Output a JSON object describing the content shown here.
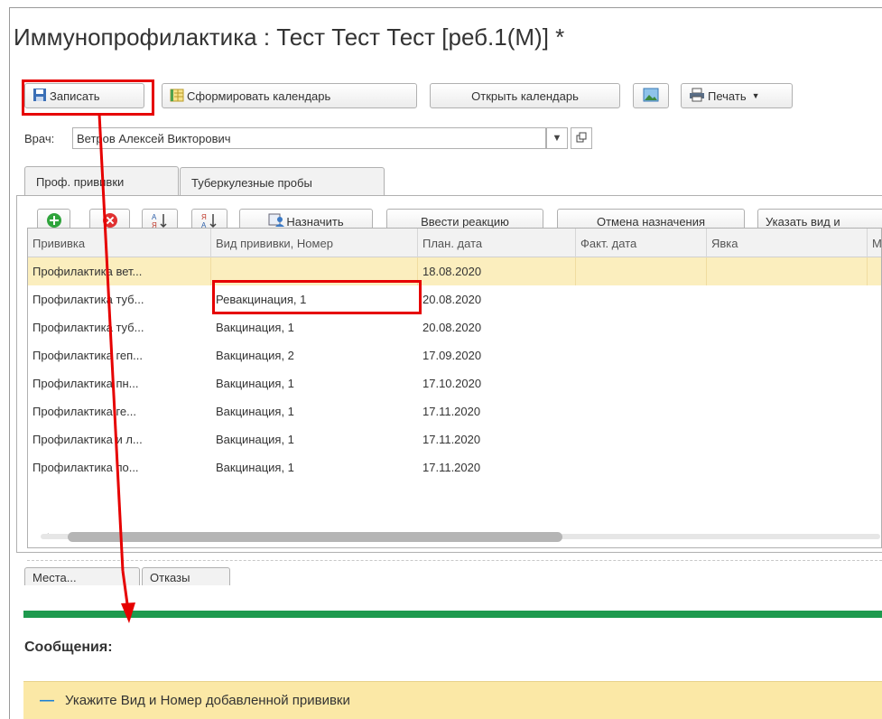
{
  "window": {
    "title": "Иммунопрофилактика : Тест Тест Тест [реб.1(М)] *"
  },
  "toolbar": {
    "save_label": "Записать",
    "form_calendar_label": "Сформировать календарь",
    "open_calendar_label": "Открыть календарь",
    "print_label": "Печать"
  },
  "doctor": {
    "label": "Врач:",
    "value": "Ветров Алексей Викторович"
  },
  "tabs": [
    "Проф. прививки",
    "Туберкулезные пробы"
  ],
  "grid_toolbar": {
    "assign_label": "Назначить",
    "enter_reaction_label": "Ввести реакцию",
    "cancel_assign_label": "Отмена назначения",
    "specify_type_label": "Указать вид и"
  },
  "table": {
    "columns": [
      "Прививка",
      "Вид прививки, Номер",
      "План. дата",
      "Факт. дата",
      "Явка",
      "М"
    ],
    "rows": [
      [
        "Профилактика вет...",
        "",
        "18.08.2020",
        "",
        ""
      ],
      [
        "Профилактика туб...",
        "Ревакцинация, 1",
        "20.08.2020",
        "",
        ""
      ],
      [
        "Профилактика туб...",
        "Вакцинация, 1",
        "20.08.2020",
        "",
        ""
      ],
      [
        "Профилактика геп...",
        "Вакцинация, 2",
        "17.09.2020",
        "",
        ""
      ],
      [
        "Профилактика пн...",
        "Вакцинация, 1",
        "17.10.2020",
        "",
        ""
      ],
      [
        "Профилактика ге...",
        "Вакцинация, 1",
        "17.11.2020",
        "",
        ""
      ],
      [
        "Профилактика и л...",
        "Вакцинация, 1",
        "17.11.2020",
        "",
        ""
      ],
      [
        "Профилактика по...",
        "Вакцинация, 1",
        "17.11.2020",
        "",
        ""
      ]
    ]
  },
  "lower_tabs": [
    "Места...",
    "Отказы"
  ],
  "messages": {
    "title": "Сообщения:",
    "items": [
      "Укажите Вид и Номер добавленной прививки"
    ]
  },
  "colors": {
    "highlight": "#e60000",
    "selected_row": "#fbeebe",
    "message_bg": "#fbe8a6",
    "green_bar": "#1e9a4e"
  }
}
